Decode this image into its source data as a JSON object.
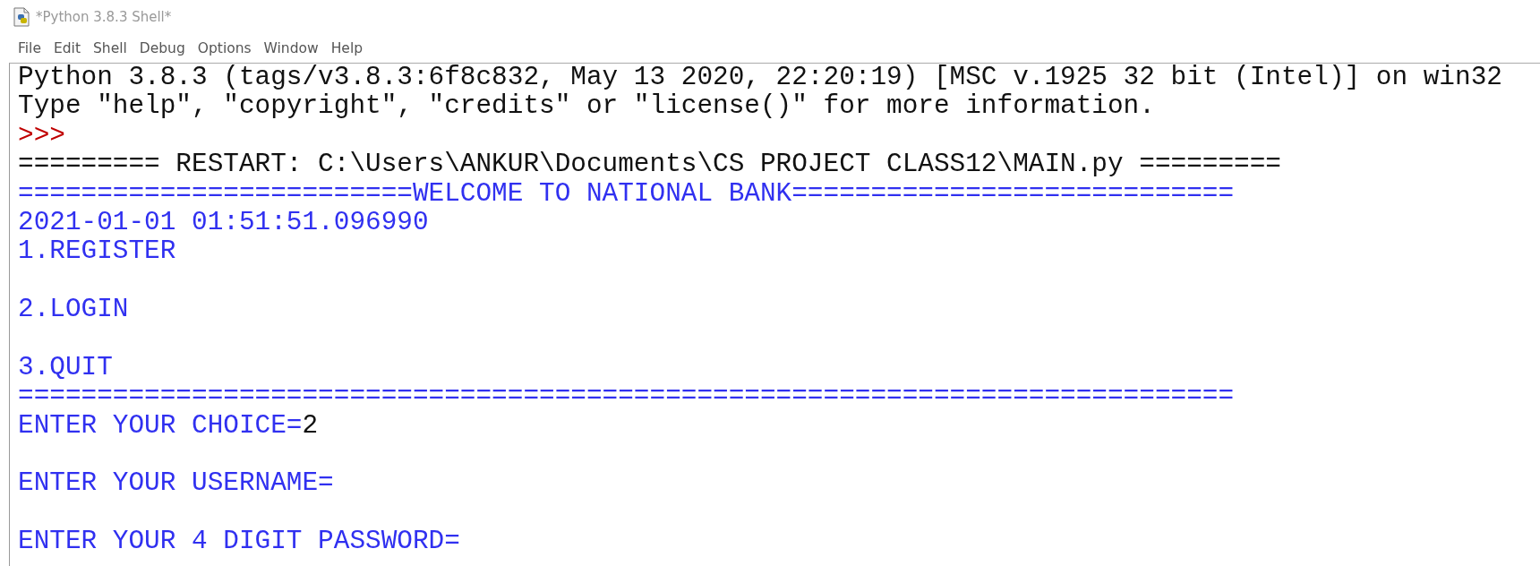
{
  "window": {
    "title": "*Python 3.8.3 Shell*"
  },
  "menu": [
    "File",
    "Edit",
    "Shell",
    "Debug",
    "Options",
    "Window",
    "Help"
  ],
  "shell_lines": [
    {
      "kind": "text",
      "parts": [
        {
          "kind": "output",
          "text": "Python 3.8.3 (tags/v3.8.3:6f8c832, May 13 2020, 22:20:19) [MSC v.1925 32 bit (Intel)] on win32"
        }
      ]
    },
    {
      "kind": "text",
      "parts": [
        {
          "kind": "output",
          "text": "Type \"help\", \"copyright\", \"credits\" or \"license()\" for more information."
        }
      ]
    },
    {
      "kind": "text",
      "parts": [
        {
          "kind": "prompt",
          "text": ">>>"
        }
      ]
    },
    {
      "kind": "text",
      "parts": [
        {
          "kind": "output",
          "text": "========= RESTART: C:\\Users\\ANKUR\\Documents\\CS PROJECT CLASS12\\MAIN.py ========="
        }
      ]
    },
    {
      "kind": "text",
      "parts": [
        {
          "kind": "stdout",
          "text": "=========================WELCOME TO NATIONAL BANK============================"
        }
      ]
    },
    {
      "kind": "text",
      "parts": [
        {
          "kind": "stdout",
          "text": "2021-01-01 01:51:51.096990"
        }
      ]
    },
    {
      "kind": "text",
      "parts": [
        {
          "kind": "stdout",
          "text": "1.REGISTER"
        }
      ]
    },
    {
      "kind": "blank"
    },
    {
      "kind": "text",
      "parts": [
        {
          "kind": "stdout",
          "text": "2.LOGIN"
        }
      ]
    },
    {
      "kind": "blank"
    },
    {
      "kind": "text",
      "parts": [
        {
          "kind": "stdout",
          "text": "3.QUIT"
        }
      ]
    },
    {
      "kind": "text",
      "parts": [
        {
          "kind": "stdout",
          "text": "============================================================================="
        }
      ]
    },
    {
      "kind": "text",
      "parts": [
        {
          "kind": "stdout",
          "text": "ENTER YOUR CHOICE="
        },
        {
          "kind": "input",
          "text": "2"
        }
      ]
    },
    {
      "kind": "blank"
    },
    {
      "kind": "text",
      "parts": [
        {
          "kind": "stdout",
          "text": "ENTER YOUR USERNAME="
        }
      ]
    },
    {
      "kind": "blank"
    },
    {
      "kind": "text",
      "parts": [
        {
          "kind": "stdout",
          "text": "ENTER YOUR 4 DIGIT PASSWORD="
        }
      ]
    }
  ]
}
